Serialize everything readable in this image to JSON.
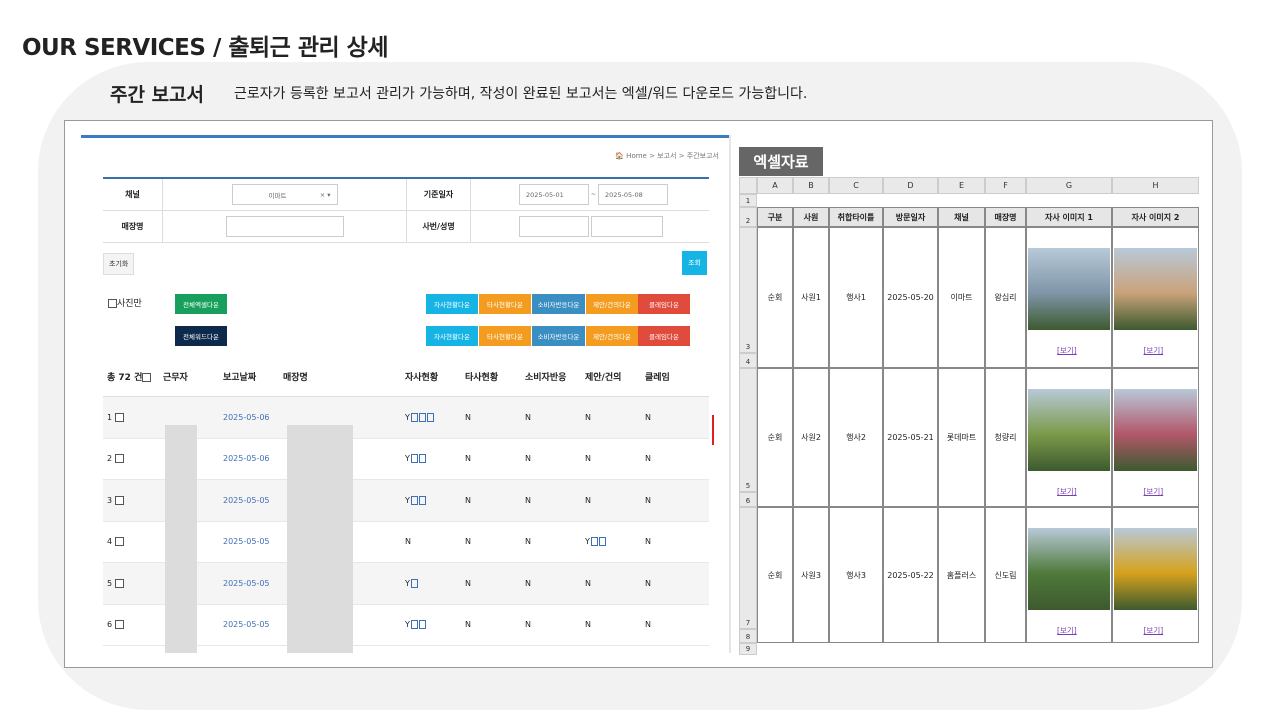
{
  "page_title": "OUR SERVICES / 출퇴근 관리 상세",
  "report": {
    "heading": "주간 보고서",
    "description": "근로자가 등록한 보고서 관리가 가능하며, 작성이 완료된 보고서는 엑셀/워드 다운로드 가능합니다."
  },
  "screen": {
    "breadcrumb": "🏠 Home  >  보고서  >  주간보고서",
    "filter": {
      "channel_label": "채널",
      "channel_value": "이마트",
      "channel_clear": "× ▾",
      "date_label": "기준일자",
      "date_from": "2025-05-01",
      "date_sep": "~",
      "date_to": "2025-05-08",
      "store_label": "매장명",
      "emp_label": "사번/성명"
    },
    "reset_label": "초기화",
    "search_label": "조회",
    "photo_only_label": "사진만",
    "all_excel_label": "전체엑셀다운",
    "all_word_label": "전체워드다운",
    "dl_buttons": [
      "자사현황다운",
      "타사현황다운",
      "소비자반응다운",
      "제안/건의다운",
      "클레임다운"
    ],
    "total_label": "총 72 건",
    "columns": [
      "근무자",
      "보고날짜",
      "매장명",
      "자사현황",
      "타사현황",
      "소비자반응",
      "제안/건의",
      "클레임"
    ],
    "rows": [
      {
        "no": "1",
        "date": "2025-05-06",
        "own": "Y",
        "other": "N",
        "consumer": "N",
        "suggest": "N",
        "claim": "N"
      },
      {
        "no": "2",
        "date": "2025-05-06",
        "own": "Y",
        "other": "N",
        "consumer": "N",
        "suggest": "N",
        "claim": "N"
      },
      {
        "no": "3",
        "date": "2025-05-05",
        "own": "Y",
        "other": "N",
        "consumer": "N",
        "suggest": "N",
        "claim": "N"
      },
      {
        "no": "4",
        "date": "2025-05-05",
        "own": "N",
        "other": "N",
        "consumer": "N",
        "suggest": "Y",
        "claim": "N"
      },
      {
        "no": "5",
        "date": "2025-05-05",
        "own": "Y",
        "other": "N",
        "consumer": "N",
        "suggest": "N",
        "claim": "N"
      },
      {
        "no": "6",
        "date": "2025-05-05",
        "own": "Y",
        "other": "N",
        "consumer": "N",
        "suggest": "N",
        "claim": "N"
      }
    ]
  },
  "excel": {
    "title": "엑셀자료",
    "col_letters": [
      "A",
      "B",
      "C",
      "D",
      "E",
      "F",
      "G",
      "H"
    ],
    "headers": [
      "구분",
      "사원",
      "취합타이틀",
      "방문일자",
      "채널",
      "매장명",
      "자사 이미지 1",
      "자사 이미지 2"
    ],
    "rows": [
      {
        "type": "순회",
        "emp": "사원1",
        "title": "행사1",
        "date": "2025-05-20",
        "channel": "이마트",
        "store": "왕십리"
      },
      {
        "type": "순회",
        "emp": "사원2",
        "title": "행사2",
        "date": "2025-05-21",
        "channel": "롯데마트",
        "store": "청량리"
      },
      {
        "type": "순회",
        "emp": "사원3",
        "title": "행사3",
        "date": "2025-05-22",
        "channel": "홈플러스",
        "store": "신도림"
      }
    ],
    "view_label": "[보기]",
    "row_numbers": [
      "1",
      "2",
      "3",
      "4",
      "5",
      "6",
      "7",
      "8",
      "9"
    ]
  },
  "colors": {
    "cyan": "#15b4e5",
    "orange": "#f39c1f",
    "steel": "#3b8ec2",
    "red": "#e14b3c",
    "green": "#17a05d",
    "navy": "#0d2a4d"
  }
}
